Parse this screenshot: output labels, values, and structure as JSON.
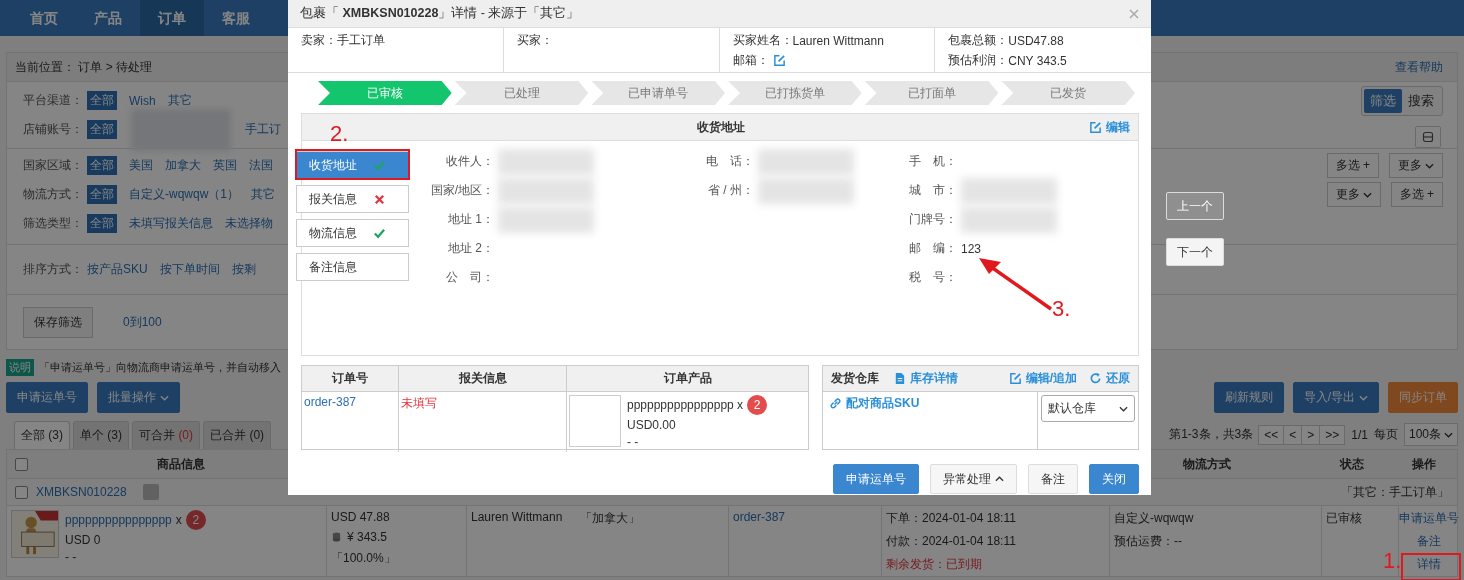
{
  "nav": {
    "tabs": [
      {
        "label": "首页",
        "selected": false
      },
      {
        "label": "产品",
        "selected": false
      },
      {
        "label": "订单",
        "selected": true
      },
      {
        "label": "客服",
        "selected": false
      }
    ]
  },
  "breadcrumb": "当前位置： 订单 > 待处理",
  "help_link": "查看帮助",
  "filter_groups": [
    {
      "rows": [
        {
          "label": "平台渠道：",
          "options": [
            {
              "label": "全部",
              "selected": true
            },
            {
              "label": "Wish",
              "selected": false
            },
            {
              "label": "其它",
              "selected": false
            }
          ],
          "toggle": [
            {
              "label": "筛选",
              "selected": true
            },
            {
              "label": "搜索",
              "selected": false
            }
          ]
        },
        {
          "label": "店铺账号：",
          "blurred": true,
          "options": [
            {
              "label": "全部",
              "selected": true
            },
            {
              "label": "手工订",
              "selected": false
            }
          ],
          "icon_button": true
        }
      ]
    },
    {
      "rows": [
        {
          "label": "国家区域：",
          "options": [
            {
              "label": "全部",
              "selected": true
            },
            {
              "label": "美国",
              "selected": false
            },
            {
              "label": "加拿大",
              "selected": false
            },
            {
              "label": "英国",
              "selected": false
            },
            {
              "label": "法国",
              "selected": false
            }
          ],
          "buttons": [
            {
              "label": "多选 +",
              "kind": "plain"
            },
            {
              "label": "更多",
              "kind": "dropdown"
            }
          ]
        },
        {
          "label": "物流方式：",
          "options": [
            {
              "label": "全部",
              "selected": true
            },
            {
              "label": "自定义-wqwqw（1）",
              "selected": false
            },
            {
              "label": "其它",
              "selected": false
            }
          ],
          "buttons": [
            {
              "label": "更多",
              "kind": "dropdown"
            },
            {
              "label": "多选 +",
              "kind": "plain"
            }
          ]
        },
        {
          "label": "筛选类型：",
          "options": [
            {
              "label": "全部",
              "selected": true
            },
            {
              "label": "未填写报关信息",
              "selected": false
            },
            {
              "label": "未选择物",
              "selected": false
            }
          ]
        }
      ]
    },
    {
      "rows": [
        {
          "label": "排序方式：",
          "options": [
            {
              "label": "按产品SKU",
              "selected": false
            },
            {
              "label": "按下单时间",
              "selected": false
            },
            {
              "label": "按剩",
              "selected": false
            }
          ]
        }
      ]
    }
  ],
  "save_filter": {
    "button": "保存筛选",
    "link": "0到100"
  },
  "notice": {
    "badge": "说明",
    "text": "「申请运单号」向物流商申请运单号，并自动移入"
  },
  "toolbar_left": [
    {
      "label": "申请运单号",
      "kind": "primary"
    },
    {
      "label": "批量操作",
      "kind": "dropdown"
    }
  ],
  "toolbar_right": [
    {
      "label": "刷新规则",
      "kind": "primary"
    },
    {
      "label": "导入/导出",
      "kind": "dropdown"
    },
    {
      "label": "同步订单",
      "kind": "warning"
    }
  ],
  "tabs": [
    {
      "label": "全部",
      "count": "(3)",
      "selected": true,
      "alert": false
    },
    {
      "label": "单个",
      "count": "(3)",
      "selected": false,
      "alert": false
    },
    {
      "label": "可合并",
      "count": "(0)",
      "selected": false,
      "alert": true
    },
    {
      "label": "已合并",
      "count": "(0)",
      "selected": false,
      "alert": false
    }
  ],
  "pagination": {
    "summary": "第1-3条，共3条",
    "buttons": [
      "<<",
      "<",
      ">",
      ">>"
    ],
    "page": "1/1",
    "per_page_label": "每页",
    "per_page": "100条"
  },
  "table": {
    "checked": false,
    "header_left": "商品信息",
    "header_right": [
      "物流方式",
      "状态",
      "操作"
    ]
  },
  "order": {
    "checked": false,
    "package_no": "XMBKSN010228",
    "source": "「其它：手工订单」",
    "product": {
      "kind": "picture",
      "name": "pppppppppppppppp",
      "times": "x",
      "qty": "2",
      "price": "USD 0",
      "sku": "- -"
    },
    "amount": "USD 47.88",
    "profit": "¥ 343.5",
    "ratio": "「100.0%」",
    "buyer": "Lauren Wittmann",
    "country": "「加拿大」",
    "order_no": "order-387",
    "times": [
      "下单：2024-01-04 18:11",
      "付款：2024-01-04 18:11"
    ],
    "deadline": "剩余发货：已到期",
    "shipping": "自定义-wqwqw",
    "freight": "预估运费：--",
    "status": "已审核",
    "actions": [
      "申请运单号",
      "备注",
      "详情"
    ]
  },
  "nav_buttons": [
    {
      "label": "上一个",
      "disabled": true
    },
    {
      "label": "下一个",
      "disabled": false
    }
  ],
  "modal": {
    "title": "包裹「 **XMBKSN010228**」详情 - 来源于「其它」",
    "info": [
      [
        {
          "label": "卖家：",
          "value": "手工订单"
        }
      ],
      [
        {
          "label": "买家："
        }
      ],
      [
        {
          "label": "买家姓名：",
          "value": "Lauren Wittmann"
        },
        {
          "label": "邮箱：",
          "kind": "edit"
        }
      ],
      [
        {
          "label": "包裹总额：",
          "value": "USD47.88"
        },
        {
          "label": "预估利润：",
          "value": "CNY 343.5"
        }
      ]
    ],
    "steps": [
      {
        "label": "已审核",
        "selected": true
      },
      {
        "label": "已处理",
        "selected": false
      },
      {
        "label": "已申请单号",
        "selected": false
      },
      {
        "label": "已打拣货单",
        "selected": false
      },
      {
        "label": "已打面单",
        "selected": false
      },
      {
        "label": "已发货",
        "selected": false
      }
    ],
    "address": {
      "title": "收货地址",
      "edit": "编辑",
      "tabs": [
        {
          "label": "收货地址",
          "selected": true,
          "kind": "valid"
        },
        {
          "label": "报关信息",
          "selected": false,
          "kind": "invalid"
        },
        {
          "label": "物流信息",
          "selected": false,
          "kind": "valid"
        },
        {
          "label": "备注信息",
          "selected": false,
          "kind": "plain"
        }
      ],
      "columns": [
        [
          {
            "label": "收件人：",
            "blurred": true
          },
          {
            "label": "国家/地区：",
            "blurred": true
          },
          {
            "label": "地址 1：",
            "blurred": true
          },
          {
            "label": "地址 2："
          },
          {
            "label": "公　司："
          }
        ],
        [
          {
            "label": "电　话：",
            "blurred": true
          },
          {
            "label": "省 / 州：",
            "blurred": true
          }
        ],
        [
          {
            "label": "手　机："
          },
          {
            "label": "城　市：",
            "blurred": true
          },
          {
            "label": "门牌号：",
            "blurred": true
          },
          {
            "label": "邮　编：",
            "value": "123"
          },
          {
            "label": "税　号："
          }
        ]
      ]
    },
    "orders_table": {
      "columns": [
        "订单号",
        "报关信息",
        "订单产品"
      ],
      "rows": [
        {
          "order_no": "order-387",
          "customs": "未填写",
          "product": {
            "name": "pppppppppppppppp x",
            "qty": "2",
            "price": "USD0.00",
            "sku": "- -"
          }
        }
      ]
    },
    "warehouse": {
      "title": "发货仓库",
      "links": [
        {
          "label": "库存详情",
          "kind": "document"
        },
        {
          "label": "编辑/追加",
          "kind": "edit"
        },
        {
          "label": "还原",
          "kind": "refresh"
        }
      ],
      "pair_link": "配对商品SKU",
      "select": "默认仓库"
    },
    "buttons": [
      {
        "label": "申请运单号",
        "kind": "primary"
      },
      {
        "label": "异常处理",
        "kind": "dropup"
      },
      {
        "label": "备注",
        "kind": "plain"
      },
      {
        "label": "关闭",
        "kind": "primary"
      }
    ]
  },
  "annotations": [
    "1.",
    "2.",
    "3."
  ]
}
